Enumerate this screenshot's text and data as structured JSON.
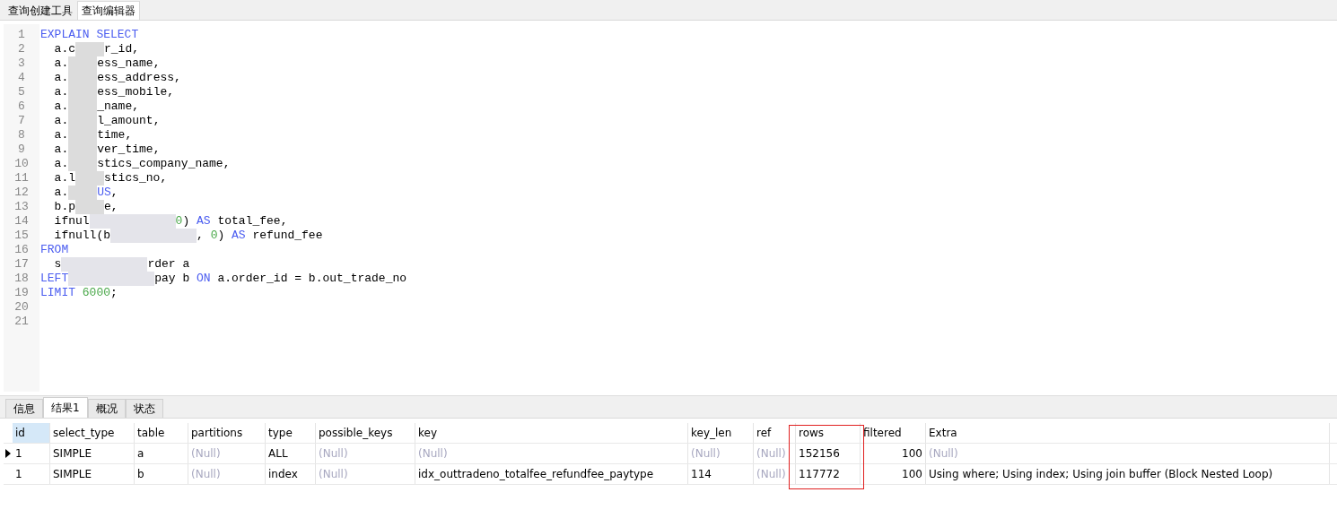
{
  "editor_tabs": [
    {
      "label": "查询创建工具",
      "selected": false
    },
    {
      "label": "查询编辑器",
      "selected": true
    }
  ],
  "code_lines": [
    {
      "no": "1",
      "parts": [
        {
          "kind": "keyword",
          "text": "EXPLAIN SELECT"
        }
      ]
    },
    {
      "no": "2",
      "parts": [
        {
          "kind": "plain",
          "text": "  a.c"
        },
        {
          "kind": "blur"
        },
        {
          "kind": "plain",
          "text": "r_id,"
        }
      ]
    },
    {
      "no": "3",
      "parts": [
        {
          "kind": "plain",
          "text": "  a."
        },
        {
          "kind": "blur"
        },
        {
          "kind": "plain",
          "text": "ess_name,"
        }
      ]
    },
    {
      "no": "4",
      "parts": [
        {
          "kind": "plain",
          "text": "  a."
        },
        {
          "kind": "blur"
        },
        {
          "kind": "plain",
          "text": "ess_address,"
        }
      ]
    },
    {
      "no": "5",
      "parts": [
        {
          "kind": "plain",
          "text": "  a."
        },
        {
          "kind": "blur"
        },
        {
          "kind": "plain",
          "text": "ess_mobile,"
        }
      ]
    },
    {
      "no": "6",
      "parts": [
        {
          "kind": "plain",
          "text": "  a."
        },
        {
          "kind": "blur"
        },
        {
          "kind": "plain",
          "text": "_name,"
        }
      ]
    },
    {
      "no": "7",
      "parts": [
        {
          "kind": "plain",
          "text": "  a."
        },
        {
          "kind": "blur"
        },
        {
          "kind": "plain",
          "text": "l_amount,"
        }
      ]
    },
    {
      "no": "8",
      "parts": [
        {
          "kind": "plain",
          "text": "  a."
        },
        {
          "kind": "blur"
        },
        {
          "kind": "plain",
          "text": "time,"
        }
      ]
    },
    {
      "no": "9",
      "parts": [
        {
          "kind": "plain",
          "text": "  a."
        },
        {
          "kind": "blur"
        },
        {
          "kind": "plain",
          "text": "ver_time,"
        }
      ]
    },
    {
      "no": "10",
      "parts": [
        {
          "kind": "plain",
          "text": "  a."
        },
        {
          "kind": "blur"
        },
        {
          "kind": "plain",
          "text": "stics_company_name,"
        }
      ]
    },
    {
      "no": "11",
      "parts": [
        {
          "kind": "plain",
          "text": "  a.l"
        },
        {
          "kind": "blur"
        },
        {
          "kind": "plain",
          "text": "stics_no,"
        }
      ]
    },
    {
      "no": "12",
      "parts": [
        {
          "kind": "plain",
          "text": "  a."
        },
        {
          "kind": "blur"
        },
        {
          "kind": "keyword",
          "text": "US"
        },
        {
          "kind": "plain",
          "text": ","
        }
      ]
    },
    {
      "no": "13",
      "parts": [
        {
          "kind": "plain",
          "text": "  b.p"
        },
        {
          "kind": "blur"
        },
        {
          "kind": "plain",
          "text": "e,"
        }
      ]
    },
    {
      "no": "14",
      "parts": [
        {
          "kind": "plain",
          "text": "  ifnul"
        },
        {
          "kind": "blur-long"
        },
        {
          "kind": "number",
          "text": "0"
        },
        {
          "kind": "plain",
          "text": ") "
        },
        {
          "kind": "keyword",
          "text": "AS"
        },
        {
          "kind": "plain",
          "text": " total_fee,"
        }
      ]
    },
    {
      "no": "15",
      "parts": [
        {
          "kind": "plain",
          "text": "  ifnull(b"
        },
        {
          "kind": "blur-long"
        },
        {
          "kind": "plain",
          "text": ", "
        },
        {
          "kind": "number",
          "text": "0"
        },
        {
          "kind": "plain",
          "text": ") "
        },
        {
          "kind": "keyword",
          "text": "AS"
        },
        {
          "kind": "plain",
          "text": " refund_fee"
        }
      ]
    },
    {
      "no": "16",
      "parts": [
        {
          "kind": "keyword",
          "text": "FROM"
        }
      ]
    },
    {
      "no": "17",
      "parts": [
        {
          "kind": "plain",
          "text": "  s"
        },
        {
          "kind": "blur-long"
        },
        {
          "kind": "plain",
          "text": "rder a"
        }
      ]
    },
    {
      "no": "18",
      "parts": [
        {
          "kind": "keyword",
          "text": "LEFT"
        },
        {
          "kind": "blur-long"
        },
        {
          "kind": "plain",
          "text": "pay b "
        },
        {
          "kind": "keyword",
          "text": "ON"
        },
        {
          "kind": "plain",
          "text": " a.order_id = b.out_trade_no"
        }
      ]
    },
    {
      "no": "19",
      "parts": [
        {
          "kind": "keyword",
          "text": "LIMIT"
        },
        {
          "kind": "number",
          "text": "6000",
          "space_before": true
        },
        {
          "kind": "plain",
          "text": ";"
        }
      ]
    },
    {
      "no": "20"
    },
    {
      "no": "21"
    }
  ],
  "result_tabs": [
    {
      "label": "信息",
      "selected": false
    },
    {
      "label": "结果1",
      "selected": true
    },
    {
      "label": "概况",
      "selected": false
    },
    {
      "label": "状态",
      "selected": false
    }
  ],
  "table": {
    "columns": [
      {
        "label": "id",
        "highlighted": false
      },
      {
        "label": "select_type",
        "highlighted": false
      },
      {
        "label": "table",
        "highlighted": false
      },
      {
        "label": "partitions",
        "highlighted": false
      },
      {
        "label": "type",
        "highlighted": false
      },
      {
        "label": "possible_keys",
        "highlighted": false
      },
      {
        "label": "key",
        "highlighted": false
      },
      {
        "label": "key_len",
        "highlighted": false
      },
      {
        "label": "ref",
        "highlighted": false
      },
      {
        "label": "rows",
        "highlighted": true
      },
      {
        "label": "filtered",
        "highlighted": false
      },
      {
        "label": "Extra",
        "highlighted": false
      }
    ],
    "rows": [
      {
        "current": true,
        "cells": [
          {
            "text": "1",
            "null": false
          },
          {
            "text": "SIMPLE",
            "null": false
          },
          {
            "text": "a",
            "null": false
          },
          {
            "text": "(Null)",
            "null": true
          },
          {
            "text": "ALL",
            "null": false
          },
          {
            "text": "(Null)",
            "null": true
          },
          {
            "text": "(Null)",
            "null": true
          },
          {
            "text": "(Null)",
            "null": true
          },
          {
            "text": "(Null)",
            "null": true
          },
          {
            "text": "152156",
            "null": false
          },
          {
            "text": "100",
            "null": false
          },
          {
            "text": "(Null)",
            "null": true
          }
        ]
      },
      {
        "current": false,
        "cells": [
          {
            "text": "1",
            "null": false
          },
          {
            "text": "SIMPLE",
            "null": false
          },
          {
            "text": "b",
            "null": false
          },
          {
            "text": "(Null)",
            "null": true
          },
          {
            "text": "index",
            "null": false
          },
          {
            "text": "(Null)",
            "null": true
          },
          {
            "text": "idx_outtradeno_totalfee_refundfee_paytype",
            "null": false
          },
          {
            "text": "114",
            "null": false
          },
          {
            "text": "(Null)",
            "null": true
          },
          {
            "text": "117772",
            "null": false
          },
          {
            "text": "100",
            "null": false
          },
          {
            "text": "Using where; Using index; Using join buffer (Block Nested Loop)",
            "null": false
          }
        ]
      }
    ]
  }
}
